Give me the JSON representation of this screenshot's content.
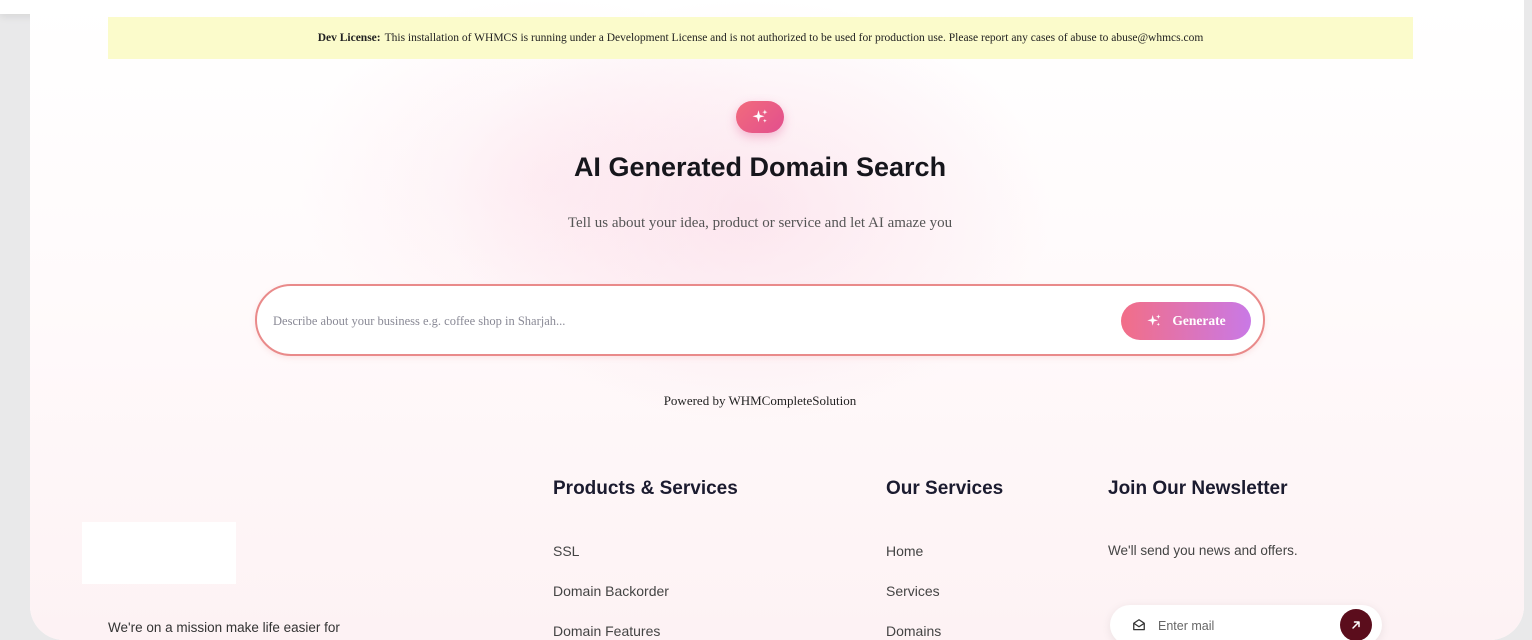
{
  "dev_license": {
    "label": "Dev License:",
    "text": "This installation of WHMCS is running under a Development License and is not authorized to be used for production use. Please report any cases of abuse to abuse@whmcs.com"
  },
  "hero": {
    "badge_icon": "sparkle-icon",
    "title": "AI Generated Domain Search",
    "subtitle": "Tell us about your idea, product or service and let AI amaze you"
  },
  "search": {
    "placeholder": "Describe about your business e.g. coffee shop in Sharjah...",
    "value": "",
    "generate_label": "Generate",
    "generate_icon": "sparkle-icon"
  },
  "powered_by": "Powered by WHMCompleteSolution",
  "footer": {
    "mission_text": "We're on a mission make life easier for",
    "products": {
      "title": "Products & Services",
      "links": [
        "SSL",
        "Domain Backorder",
        "Domain Features"
      ]
    },
    "services": {
      "title": "Our Services",
      "links": [
        "Home",
        "Services",
        "Domains"
      ]
    },
    "newsletter": {
      "title": "Join Our Newsletter",
      "text": "We'll send you news and offers.",
      "placeholder": "Enter mail",
      "mail_icon": "envelope-icon",
      "submit_icon": "arrow-up-right-icon"
    }
  },
  "colors": {
    "accent_gradient_start": "#f26e87",
    "accent_gradient_end": "#c979e6",
    "dev_banner_bg": "#fbfbcb",
    "search_border": "#e98a8a",
    "submit_bg": "#5b0d1c"
  }
}
